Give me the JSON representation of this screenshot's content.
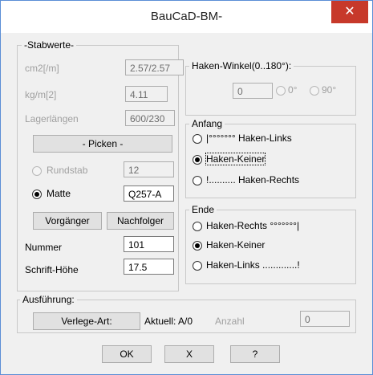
{
  "window": {
    "title": "BauCaD-BM-",
    "close_glyph": "✕"
  },
  "stabwerte": {
    "title": "-Stabwerte-",
    "cm2_label": "cm2[/m]",
    "cm2_value": "2.57/2.57",
    "kgm_label": "kg/m[2]",
    "kgm_value": "4.11",
    "lager_label": "Lagerlängen",
    "lager_value": "600/230",
    "picken_label": "- Picken -",
    "rundstab_label": "Rundstab",
    "rundstab_value": "12",
    "matte_label": "Matte",
    "matte_value": "Q257-A",
    "vorgaenger_label": "Vorgänger",
    "nachfolger_label": "Nachfolger",
    "nummer_label": "Nummer",
    "nummer_value": "101",
    "schrift_label": "Schrift-Höhe",
    "schrift_value": "17.5"
  },
  "haken": {
    "title": "Haken-Winkel(0..180°):",
    "value": "0",
    "opt0_label": "0°",
    "opt90_label": "90°"
  },
  "anfang": {
    "title": "Anfang",
    "options": [
      "|°°°°°°° Haken-Links",
      "Haken-Keiner",
      "!.......... Haken-Rechts"
    ]
  },
  "ende": {
    "title": "Ende",
    "options": [
      "Haken-Rechts °°°°°°°|",
      "Haken-Keiner",
      "Haken-Links .............!"
    ]
  },
  "ausfuehrung": {
    "title": "Ausführung:",
    "verlege_label": "Verlege-Art:",
    "aktuell_label": "Aktuell: A/0",
    "anzahl_label": "Anzahl",
    "anzahl_value": "0"
  },
  "buttons": {
    "ok": "OK",
    "cancel": "X",
    "help": "?"
  }
}
